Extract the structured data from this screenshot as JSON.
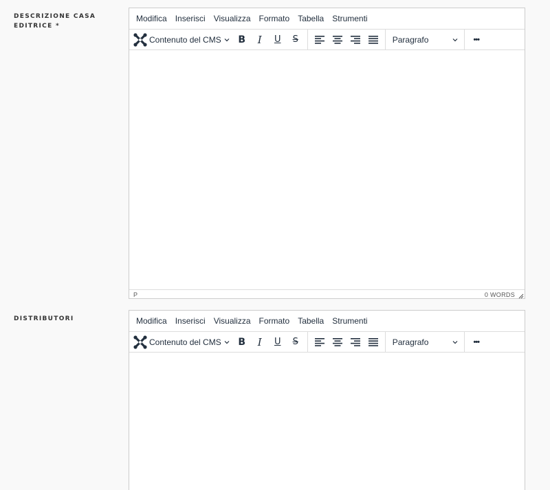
{
  "fields": [
    {
      "label": "DESCRIZIONE CASA EDITRICE *",
      "menubar": [
        "Modifica",
        "Inserisci",
        "Visualizza",
        "Formato",
        "Tabella",
        "Strumenti"
      ],
      "toolbar": {
        "cms_label": "Contenuto del CMS",
        "bold": "B",
        "italic": "I",
        "underline": "U",
        "strikethrough": "S",
        "block_format": "Paragrafo",
        "more": "•••"
      },
      "status_path": "P",
      "word_count": "0 WORDS"
    },
    {
      "label": "DISTRIBUTORI",
      "menubar": [
        "Modifica",
        "Inserisci",
        "Visualizza",
        "Formato",
        "Tabella",
        "Strumenti"
      ],
      "toolbar": {
        "cms_label": "Contenuto del CMS",
        "bold": "B",
        "italic": "I",
        "underline": "U",
        "strikethrough": "S",
        "block_format": "Paragrafo",
        "more": "•••"
      }
    }
  ],
  "icons": {
    "cms": "joomla-logo-icon",
    "align": [
      "align-left-icon",
      "align-center-icon",
      "align-right-icon",
      "align-justify-icon"
    ],
    "dropdown": "chevron-down-icon"
  },
  "colors": {
    "icon": "#222f3e",
    "border": "#cccccc",
    "background": "#f9f9f9"
  }
}
